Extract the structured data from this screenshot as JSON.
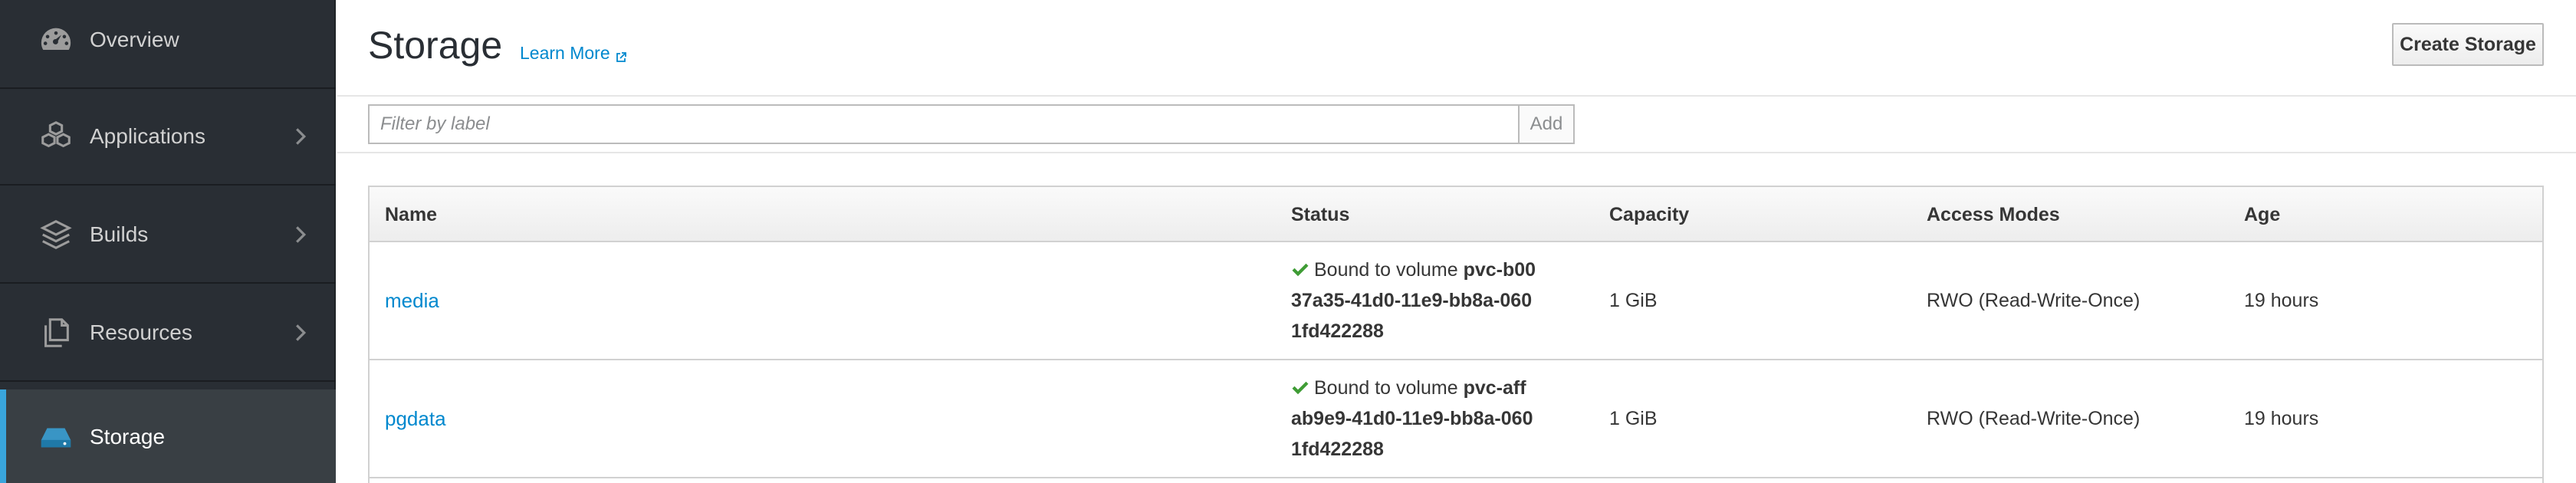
{
  "sidebar": {
    "items": [
      {
        "label": "Overview",
        "icon": "dashboard-icon",
        "has_children": false,
        "active": false
      },
      {
        "label": "Applications",
        "icon": "cubes-icon",
        "has_children": true,
        "active": false
      },
      {
        "label": "Builds",
        "icon": "layers-icon",
        "has_children": true,
        "active": false
      },
      {
        "label": "Resources",
        "icon": "files-icon",
        "has_children": true,
        "active": false
      },
      {
        "label": "Storage",
        "icon": "storage-icon",
        "has_children": false,
        "active": true
      }
    ]
  },
  "header": {
    "title": "Storage",
    "learn_more": "Learn More",
    "create_button": "Create Storage"
  },
  "filter": {
    "placeholder": "Filter by label",
    "value": "",
    "add_label": "Add"
  },
  "table": {
    "columns": [
      "Name",
      "Status",
      "Capacity",
      "Access Modes",
      "Age"
    ],
    "rows": [
      {
        "name": "media",
        "status_prefix": "Bound to volume",
        "volume": "pvc-b0037a35-41d0-11e9-bb8a-0601fd422288",
        "capacity": "1 GiB",
        "access_modes": "RWO (Read-Write-Once)",
        "age": "19 hours"
      },
      {
        "name": "pgdata",
        "status_prefix": "Bound to volume",
        "volume": "pvc-affab9e9-41d0-11e9-bb8a-0601fd422288",
        "capacity": "1 GiB",
        "access_modes": "RWO (Read-Write-Once)",
        "age": "19 hours"
      }
    ]
  },
  "colors": {
    "sidebar_bg": "#292e34",
    "active_accent": "#39a5dc",
    "link": "#0088ce",
    "success": "#3f9c35"
  }
}
